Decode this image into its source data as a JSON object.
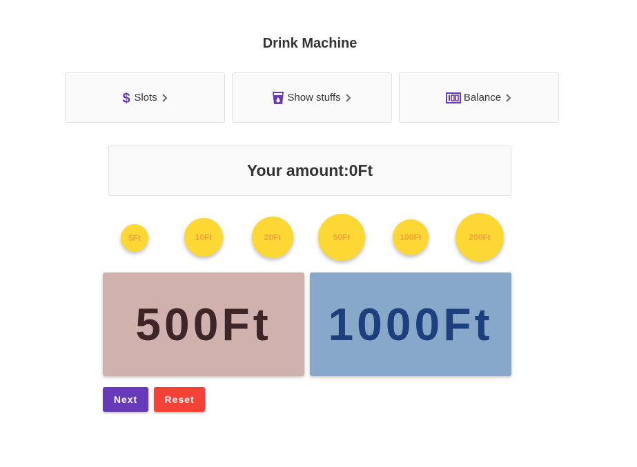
{
  "title": "Drink Machine",
  "menu": [
    {
      "label": "Slots",
      "icon": "dollar-icon"
    },
    {
      "label": "Show stuffs",
      "icon": "drink-cup-icon"
    },
    {
      "label": "Balance",
      "icon": "balance-counter-icon"
    }
  ],
  "amount": {
    "label": "Your amount:",
    "value": "0Ft"
  },
  "coins": [
    "5Ft",
    "10Ft",
    "20Ft",
    "50Ft",
    "100Ft",
    "200Ft"
  ],
  "notes": [
    "500Ft",
    "1000Ft"
  ],
  "buttons": {
    "next": "Next",
    "reset": "Reset"
  },
  "colors": {
    "accent": "#673ab7",
    "danger": "#f44336",
    "coin": "#fdd835",
    "coin_text": "#f2a23a",
    "note_500_bg": "#d0b1ad",
    "note_500_text": "#3e2527",
    "note_1000_bg": "#87a8c8",
    "note_1000_text": "#1e3f7e"
  }
}
